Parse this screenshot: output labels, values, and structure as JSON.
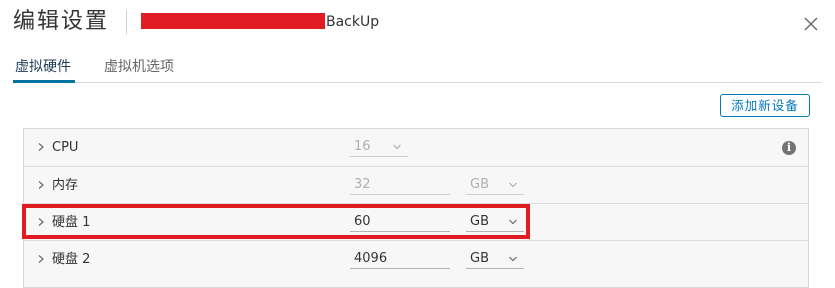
{
  "header": {
    "title": "编辑设置",
    "vm_name_suffix": "BackUp"
  },
  "tabs": [
    {
      "label": "虚拟硬件",
      "active": true
    },
    {
      "label": "虚拟机选项",
      "active": false
    }
  ],
  "toolbar": {
    "add_device_label": "添加新设备"
  },
  "hardware": {
    "cpu": {
      "label": "CPU",
      "value": "16"
    },
    "memory": {
      "label": "内存",
      "value": "32",
      "unit": "GB"
    },
    "disk1": {
      "label": "硬盘 1",
      "value": "60",
      "unit": "GB"
    },
    "disk2": {
      "label": "硬盘 2",
      "value": "4096",
      "unit": "GB"
    }
  },
  "icons": {
    "close": "close-icon",
    "info": "info-icon",
    "expand": "chevron-right-icon",
    "dropdown": "chevron-down-icon"
  },
  "colors": {
    "accent": "#0079b8",
    "highlight": "#e11b22",
    "redaction": "#e11b22"
  }
}
